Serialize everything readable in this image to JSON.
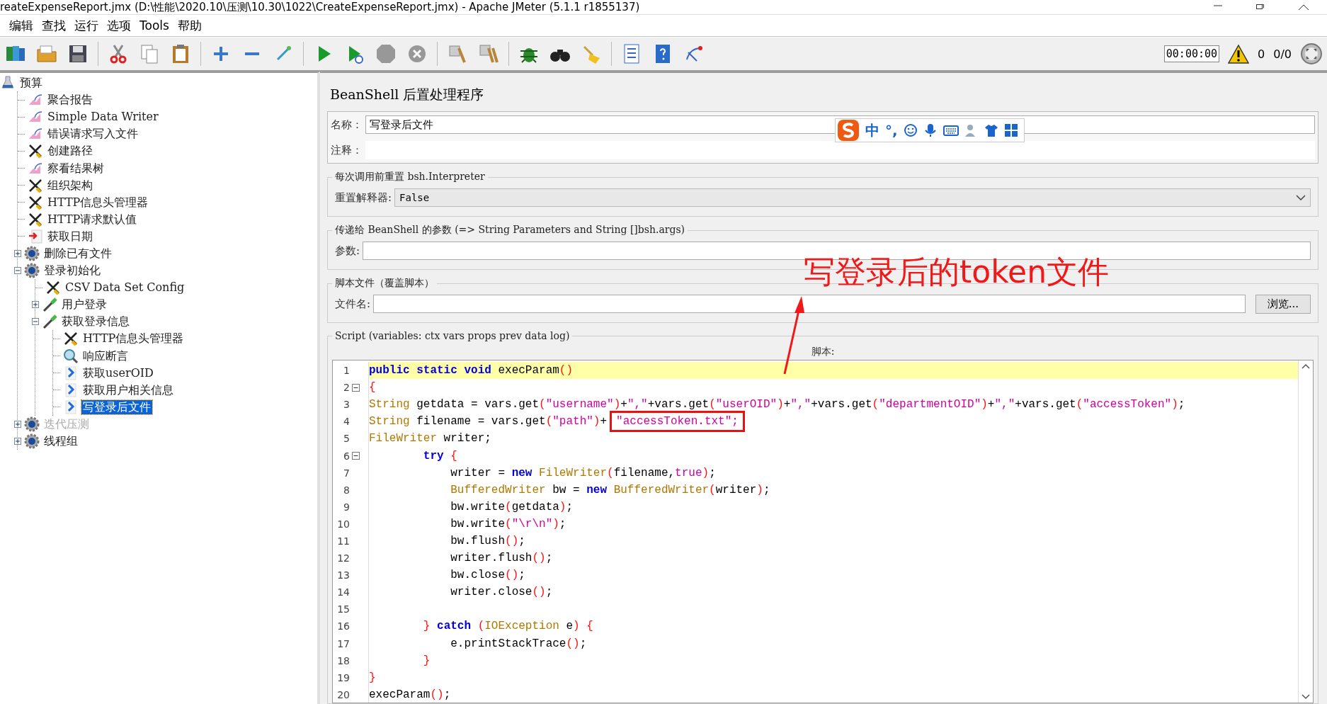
{
  "window": {
    "title": "reateExpenseReport.jmx (D:\\性能\\2020.10\\压测\\10.30\\1022\\CreateExpenseReport.jmx) - Apache JMeter (5.1.1 r1855137)"
  },
  "menu": [
    "编辑",
    "查找",
    "运行",
    "选项",
    "Tools",
    "帮助"
  ],
  "toolbar": {
    "buttons": [
      {
        "kind": "templates",
        "disabled": false
      },
      {
        "kind": "open",
        "disabled": false
      },
      {
        "kind": "save",
        "disabled": false
      },
      {
        "kind": "separator",
        "disabled": false
      },
      {
        "kind": "cut",
        "disabled": false
      },
      {
        "kind": "copy",
        "disabled": false
      },
      {
        "kind": "paste",
        "disabled": false
      },
      {
        "kind": "separator",
        "disabled": false
      },
      {
        "kind": "expand",
        "disabled": false
      },
      {
        "kind": "collapse",
        "disabled": false
      },
      {
        "kind": "toggle",
        "disabled": false
      },
      {
        "kind": "separator",
        "disabled": false
      },
      {
        "kind": "start",
        "disabled": false
      },
      {
        "kind": "start-no-timers",
        "disabled": false
      },
      {
        "kind": "stop",
        "disabled": true
      },
      {
        "kind": "shutdown",
        "disabled": true
      },
      {
        "kind": "separator",
        "disabled": false
      },
      {
        "kind": "clear",
        "disabled": false
      },
      {
        "kind": "clear-all",
        "disabled": false
      },
      {
        "kind": "separator",
        "disabled": false
      },
      {
        "kind": "bug",
        "disabled": false
      },
      {
        "kind": "search",
        "disabled": false
      },
      {
        "kind": "reset-search",
        "disabled": false
      },
      {
        "kind": "separator",
        "disabled": false
      },
      {
        "kind": "function-helper",
        "disabled": false
      },
      {
        "kind": "help",
        "disabled": false
      },
      {
        "kind": "remote",
        "disabled": false
      }
    ],
    "timer": "00:00:00",
    "warnings": "0",
    "threads": "0/0"
  },
  "tree": {
    "label": "预算",
    "kind": "testplan",
    "selected": false,
    "disabled": false,
    "children": [
      {
        "label": "聚合报告",
        "kind": "listener",
        "selected": false,
        "disabled": false
      },
      {
        "label": "Simple Data Writer",
        "kind": "listener",
        "selected": false,
        "disabled": false
      },
      {
        "label": "错误请求写入文件",
        "kind": "listener",
        "selected": false,
        "disabled": false
      },
      {
        "label": "创建路径",
        "kind": "config",
        "selected": false,
        "disabled": false
      },
      {
        "label": "察看结果树",
        "kind": "listener",
        "selected": false,
        "disabled": false
      },
      {
        "label": "组织架构",
        "kind": "config",
        "selected": false,
        "disabled": false
      },
      {
        "label": "HTTP信息头管理器",
        "kind": "config",
        "selected": false,
        "disabled": false
      },
      {
        "label": "HTTP请求默认值",
        "kind": "config",
        "selected": false,
        "disabled": false
      },
      {
        "label": "获取日期",
        "kind": "preprocessor",
        "selected": false,
        "disabled": false
      },
      {
        "label": "删除已有文件",
        "kind": "threadgroup",
        "selected": false,
        "disabled": false,
        "expanded": false
      },
      {
        "label": "登录初始化",
        "kind": "threadgroup",
        "selected": false,
        "disabled": false,
        "expanded": true,
        "children": [
          {
            "label": "CSV Data Set Config",
            "kind": "config",
            "selected": false,
            "disabled": false
          },
          {
            "label": "用户登录",
            "kind": "sampler",
            "selected": false,
            "disabled": false,
            "expanded": false
          },
          {
            "label": "获取登录信息",
            "kind": "sampler",
            "selected": false,
            "disabled": false,
            "expanded": true,
            "children": [
              {
                "label": "HTTP信息头管理器",
                "kind": "config",
                "selected": false,
                "disabled": false
              },
              {
                "label": "响应断言",
                "kind": "assertion",
                "selected": false,
                "disabled": false
              },
              {
                "label": "获取userOID",
                "kind": "postprocessor",
                "selected": false,
                "disabled": false
              },
              {
                "label": "获取用户相关信息",
                "kind": "postprocessor",
                "selected": false,
                "disabled": false
              },
              {
                "label": "写登录后文件",
                "kind": "postprocessor",
                "selected": true,
                "disabled": false
              }
            ]
          }
        ]
      },
      {
        "label": "迭代压测",
        "kind": "threadgroup",
        "selected": false,
        "disabled": true,
        "expanded": false
      },
      {
        "label": "线程组",
        "kind": "threadgroup",
        "selected": false,
        "disabled": false,
        "expanded": false
      }
    ]
  },
  "editor": {
    "title": "BeanShell 后置处理程序",
    "name_label": "名称：",
    "name_value": "写登录后文件",
    "comment_label": "注释：",
    "groups": [
      {
        "kind": "select",
        "legend": "每次调用前重置 bsh.Interpreter",
        "label": "重置解释器:",
        "value": "False"
      },
      {
        "kind": "text",
        "legend": "传递给 BeanShell 的参数 (=> String Parameters and String []bsh.args)",
        "label": "参数:"
      },
      {
        "kind": "file",
        "legend": "脚本文件（覆盖脚本）",
        "label": "文件名:",
        "button": "浏览..."
      }
    ],
    "script": {
      "legend": "Script (variables: ctx vars props prev data log)",
      "label": "脚本:",
      "lines": [
        {
          "number": "1",
          "fold": false,
          "current": true,
          "tokens": [
            {
              "kind": "kw",
              "text": "public static void"
            },
            {
              "kind": "plain",
              "text": " execParam"
            },
            {
              "kind": "paren",
              "text": "()"
            }
          ]
        },
        {
          "number": "2",
          "fold": true,
          "current": false,
          "tokens": [
            {
              "kind": "paren",
              "text": "{"
            }
          ]
        },
        {
          "number": "3",
          "fold": false,
          "current": false,
          "tokens": [
            {
              "kind": "type",
              "text": "String"
            },
            {
              "kind": "plain",
              "text": " getdata = vars.get"
            },
            {
              "kind": "paren",
              "text": "("
            },
            {
              "kind": "str",
              "text": "\"username\""
            },
            {
              "kind": "paren",
              "text": ")"
            },
            {
              "kind": "plain",
              "text": "+"
            },
            {
              "kind": "str",
              "text": "\",\""
            },
            {
              "kind": "plain",
              "text": "+vars.get"
            },
            {
              "kind": "paren",
              "text": "("
            },
            {
              "kind": "str",
              "text": "\"userOID\""
            },
            {
              "kind": "paren",
              "text": ")"
            },
            {
              "kind": "plain",
              "text": "+"
            },
            {
              "kind": "str",
              "text": "\",\""
            },
            {
              "kind": "plain",
              "text": "+vars.get"
            },
            {
              "kind": "paren",
              "text": "("
            },
            {
              "kind": "str",
              "text": "\"departmentOID\""
            },
            {
              "kind": "paren",
              "text": ")"
            },
            {
              "kind": "plain",
              "text": "+"
            },
            {
              "kind": "str",
              "text": "\",\""
            },
            {
              "kind": "plain",
              "text": "+vars.get"
            },
            {
              "kind": "paren",
              "text": "("
            },
            {
              "kind": "str",
              "text": "\"accessToken\""
            },
            {
              "kind": "paren",
              "text": ")"
            },
            {
              "kind": "plain",
              "text": ";"
            }
          ]
        },
        {
          "number": "4",
          "fold": false,
          "current": false,
          "tokens": [
            {
              "kind": "type",
              "text": "String"
            },
            {
              "kind": "plain",
              "text": " filename = vars.get"
            },
            {
              "kind": "paren",
              "text": "("
            },
            {
              "kind": "str",
              "text": "\"path\""
            },
            {
              "kind": "paren",
              "text": ")"
            },
            {
              "kind": "plain",
              "text": "+"
            },
            {
              "kind": "marked",
              "text": "\"accessToken.txt\";"
            }
          ]
        },
        {
          "number": "5",
          "fold": false,
          "current": false,
          "tokens": [
            {
              "kind": "type",
              "text": "FileWriter"
            },
            {
              "kind": "plain",
              "text": " writer;"
            }
          ]
        },
        {
          "number": "6",
          "fold": true,
          "current": false,
          "tokens": [
            {
              "kind": "kw",
              "text": "        try"
            },
            {
              "kind": "paren",
              "text": " {"
            }
          ]
        },
        {
          "number": "7",
          "fold": false,
          "current": false,
          "tokens": [
            {
              "kind": "plain",
              "text": "            writer = "
            },
            {
              "kind": "kw",
              "text": "new"
            },
            {
              "kind": "type",
              "text": " FileWriter"
            },
            {
              "kind": "paren",
              "text": "("
            },
            {
              "kind": "plain",
              "text": "filename,"
            },
            {
              "kind": "str",
              "text": "true"
            },
            {
              "kind": "paren",
              "text": ")"
            },
            {
              "kind": "plain",
              "text": ";"
            }
          ]
        },
        {
          "number": "8",
          "fold": false,
          "current": false,
          "tokens": [
            {
              "kind": "type",
              "text": "            BufferedWriter"
            },
            {
              "kind": "plain",
              "text": " bw = "
            },
            {
              "kind": "kw",
              "text": "new"
            },
            {
              "kind": "type",
              "text": " BufferedWriter"
            },
            {
              "kind": "paren",
              "text": "("
            },
            {
              "kind": "plain",
              "text": "writer"
            },
            {
              "kind": "paren",
              "text": ")"
            },
            {
              "kind": "plain",
              "text": ";"
            }
          ]
        },
        {
          "number": "9",
          "fold": false,
          "current": false,
          "tokens": [
            {
              "kind": "plain",
              "text": "            bw.write"
            },
            {
              "kind": "paren",
              "text": "("
            },
            {
              "kind": "plain",
              "text": "getdata"
            },
            {
              "kind": "paren",
              "text": ")"
            },
            {
              "kind": "plain",
              "text": ";"
            }
          ]
        },
        {
          "number": "10",
          "fold": false,
          "current": false,
          "tokens": [
            {
              "kind": "plain",
              "text": "            bw.write"
            },
            {
              "kind": "paren",
              "text": "("
            },
            {
              "kind": "str",
              "text": "\"\\r\\n\""
            },
            {
              "kind": "paren",
              "text": ")"
            },
            {
              "kind": "plain",
              "text": ";"
            }
          ]
        },
        {
          "number": "11",
          "fold": false,
          "current": false,
          "tokens": [
            {
              "kind": "plain",
              "text": "            bw.flush"
            },
            {
              "kind": "paren",
              "text": "()"
            },
            {
              "kind": "plain",
              "text": ";"
            }
          ]
        },
        {
          "number": "12",
          "fold": false,
          "current": false,
          "tokens": [
            {
              "kind": "plain",
              "text": "            writer.flush"
            },
            {
              "kind": "paren",
              "text": "()"
            },
            {
              "kind": "plain",
              "text": ";"
            }
          ]
        },
        {
          "number": "13",
          "fold": false,
          "current": false,
          "tokens": [
            {
              "kind": "plain",
              "text": "            bw.close"
            },
            {
              "kind": "paren",
              "text": "()"
            },
            {
              "kind": "plain",
              "text": ";"
            }
          ]
        },
        {
          "number": "14",
          "fold": false,
          "current": false,
          "tokens": [
            {
              "kind": "plain",
              "text": "            writer.close"
            },
            {
              "kind": "paren",
              "text": "()"
            },
            {
              "kind": "plain",
              "text": ";"
            }
          ]
        },
        {
          "number": "15",
          "fold": false,
          "current": false
        },
        {
          "number": "16",
          "fold": false,
          "current": false,
          "tokens": [
            {
              "kind": "paren",
              "text": "        }"
            },
            {
              "kind": "kw",
              "text": " catch"
            },
            {
              "kind": "paren",
              "text": " ("
            },
            {
              "kind": "type",
              "text": "IOException"
            },
            {
              "kind": "plain",
              "text": " e"
            },
            {
              "kind": "paren",
              "text": ") {"
            }
          ]
        },
        {
          "number": "17",
          "fold": false,
          "current": false,
          "tokens": [
            {
              "kind": "plain",
              "text": "            e.printStackTrace"
            },
            {
              "kind": "paren",
              "text": "()"
            },
            {
              "kind": "plain",
              "text": ";"
            }
          ]
        },
        {
          "number": "18",
          "fold": false,
          "current": false,
          "tokens": [
            {
              "kind": "paren",
              "text": "        }"
            }
          ]
        },
        {
          "number": "19",
          "fold": false,
          "current": false,
          "tokens": [
            {
              "kind": "paren",
              "text": "}"
            }
          ]
        },
        {
          "number": "20",
          "fold": false,
          "current": false,
          "tokens": [
            {
              "kind": "plain",
              "text": "execParam"
            },
            {
              "kind": "paren",
              "text": "()"
            },
            {
              "kind": "plain",
              "text": ";"
            }
          ]
        }
      ]
    }
  },
  "ime_bar": {
    "mode": "中",
    "punct": "°,"
  },
  "annotation": {
    "text": "写登录后的token文件"
  }
}
